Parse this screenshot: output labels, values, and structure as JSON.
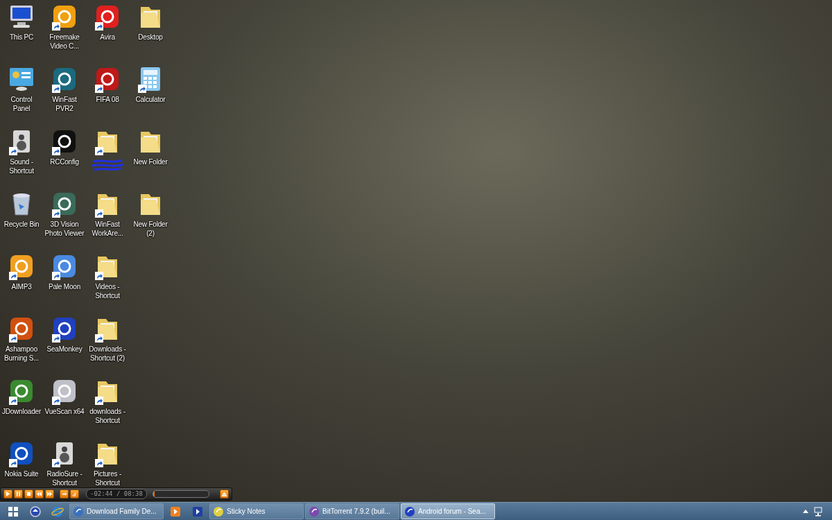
{
  "desktop_icons": [
    {
      "label": "This PC",
      "kind": "computer",
      "shortcut": false
    },
    {
      "label": "Control\nPanel",
      "kind": "panel",
      "shortcut": false
    },
    {
      "label": "Sound -\nShortcut",
      "kind": "speaker",
      "shortcut": true
    },
    {
      "label": "Recycle Bin",
      "kind": "bin",
      "shortcut": false
    },
    {
      "label": "AIMP3",
      "kind": "app",
      "color": "#f0a020",
      "shortcut": true
    },
    {
      "label": "Ashampoo\nBurning S...",
      "kind": "app",
      "color": "#d05010",
      "shortcut": true
    },
    {
      "label": "JDownloader",
      "kind": "app",
      "color": "#3a8a30",
      "shortcut": true
    },
    {
      "label": "Nokia Suite",
      "kind": "app",
      "color": "#1050c0",
      "shortcut": true
    },
    {
      "label": "Freemake\nVideo C...",
      "kind": "app",
      "color": "#f0a010",
      "shortcut": true
    },
    {
      "label": "WinFast\nPVR2",
      "kind": "app",
      "color": "#1a6a80",
      "shortcut": true
    },
    {
      "label": "RCConfig",
      "kind": "app",
      "color": "#101010",
      "shortcut": true
    },
    {
      "label": "3D Vision\nPhoto Viewer",
      "kind": "app",
      "color": "#3a6a5a",
      "shortcut": true
    },
    {
      "label": "Pale Moon",
      "kind": "app",
      "color": "#4a8ae0",
      "shortcut": true
    },
    {
      "label": "SeaMonkey",
      "kind": "app",
      "color": "#2040c0",
      "shortcut": true
    },
    {
      "label": "VueScan x64",
      "kind": "app",
      "color": "#c0c0c8",
      "shortcut": true
    },
    {
      "label": "RadioSure -\nShortcut",
      "kind": "speaker",
      "shortcut": true
    },
    {
      "label": "Avira",
      "kind": "app",
      "color": "#e02020",
      "shortcut": true
    },
    {
      "label": "FIFA 08",
      "kind": "app",
      "color": "#c01818",
      "shortcut": true
    },
    {
      "kind": "folder",
      "shortcut": true,
      "scribbled": true
    },
    {
      "label": "WinFast\nWorkAre...",
      "kind": "folder",
      "shortcut": true
    },
    {
      "label": "Videos -\nShortcut",
      "kind": "folder",
      "shortcut": true
    },
    {
      "label": "Downloads -\nShortcut (2)",
      "kind": "folder",
      "shortcut": true
    },
    {
      "label": "downloads -\nShortcut",
      "kind": "folder",
      "shortcut": true
    },
    {
      "label": "Pictures -\nShortcut",
      "kind": "folder",
      "shortcut": true
    },
    {
      "label": "Desktop",
      "kind": "folder",
      "shortcut": false
    },
    {
      "label": "Calculator",
      "kind": "calculator",
      "shortcut": true
    },
    {
      "label": "New Folder",
      "kind": "folder",
      "shortcut": false
    },
    {
      "label": "New Folder\n(2)",
      "kind": "folder",
      "shortcut": false
    }
  ],
  "player": {
    "time": "-02:44 / 08:38",
    "level": 0
  },
  "taskbar": {
    "pinned": [
      {
        "kind": "switch"
      },
      {
        "kind": "browser"
      }
    ],
    "tasks": [
      {
        "kind": "task",
        "label": "Download Family De...",
        "color": "#3a70c0",
        "selected": false
      },
      {
        "kind": "pin",
        "color": "#f08020"
      },
      {
        "kind": "pin",
        "color": "#2040a0"
      },
      {
        "kind": "task",
        "label": "Sticky Notes",
        "color": "#e0d040",
        "selected": false
      },
      {
        "kind": "task",
        "label": "BitTorrent 7.9.2  (buil...",
        "color": "#7a4ab0",
        "selected": false
      },
      {
        "kind": "task",
        "label": "Android forum - Sea...",
        "color": "#2040c0",
        "selected": true
      }
    ]
  }
}
